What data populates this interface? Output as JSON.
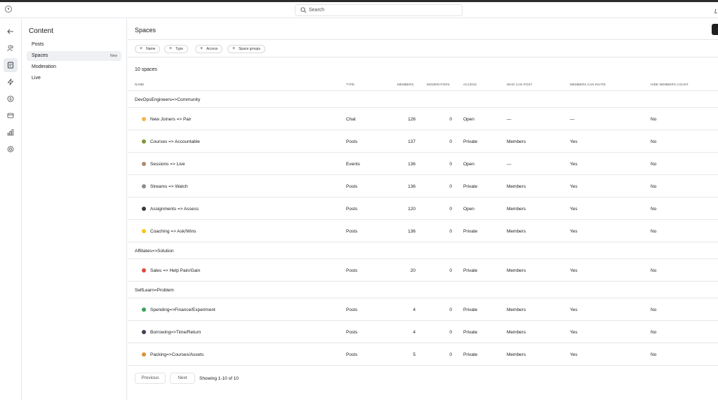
{
  "topbar": {
    "search_placeholder": "Search",
    "avatar_letter": "L"
  },
  "subnav": {
    "title": "Content",
    "items": [
      {
        "label": "Posts",
        "badge": ""
      },
      {
        "label": "Spaces",
        "badge": "New"
      },
      {
        "label": "Moderation",
        "badge": ""
      },
      {
        "label": "Live",
        "badge": ""
      }
    ]
  },
  "main": {
    "title": "Spaces",
    "filters": [
      "Name",
      "Type",
      "Access",
      "Space groups"
    ],
    "count": "10 spaces",
    "columns": [
      "NAME",
      "TYPE",
      "MEMBERS",
      "MODERATORS",
      "ACCESS",
      "WHO CAN POST",
      "MEMBERS CAN INVITE",
      "HIDE MEMBERS COUNT"
    ],
    "groups": [
      {
        "label": "DevOpsEngineers=>Community",
        "rows": [
          {
            "icon": "waving-hand-icon",
            "color": "#f2b84b",
            "name": "New Joiners => Pair",
            "type": "Chat",
            "members": "126",
            "moderators": "0",
            "access": "Open",
            "who_can_post": "—",
            "can_invite": "—",
            "hide_count": "No"
          },
          {
            "icon": "books-icon",
            "color": "#7a9a3a",
            "name": "Courses => Accountable",
            "type": "Posts",
            "members": "137",
            "moderators": "0",
            "access": "Private",
            "who_can_post": "Members",
            "can_invite": "Yes",
            "hide_count": "No"
          },
          {
            "icon": "person-icon",
            "color": "#b08a6a",
            "name": "Sessions => Live",
            "type": "Events",
            "members": "136",
            "moderators": "0",
            "access": "Open",
            "who_can_post": "—",
            "can_invite": "Yes",
            "hide_count": "No"
          },
          {
            "icon": "streams-icon",
            "color": "#8c8c8c",
            "name": "Streams => Watch",
            "type": "Posts",
            "members": "136",
            "moderators": "0",
            "access": "Private",
            "who_can_post": "Members",
            "can_invite": "Yes",
            "hide_count": "No"
          },
          {
            "icon": "eyes-icon",
            "color": "#3a3a3a",
            "name": "Assignments => Assess",
            "type": "Posts",
            "members": "120",
            "moderators": "0",
            "access": "Open",
            "who_can_post": "Members",
            "can_invite": "Yes",
            "hide_count": "No"
          },
          {
            "icon": "sparkle-icon",
            "color": "#f5c71a",
            "name": "Coaching => Ask/Wins",
            "type": "Posts",
            "members": "136",
            "moderators": "0",
            "access": "Private",
            "who_can_post": "Members",
            "can_invite": "Yes",
            "hide_count": "No"
          }
        ]
      },
      {
        "label": "Affiliates=>Solution",
        "rows": [
          {
            "icon": "pencil-icon",
            "color": "#e0483e",
            "name": "Sales => Help Pain/Gain",
            "type": "Posts",
            "members": "20",
            "moderators": "0",
            "access": "Private",
            "who_can_post": "Members",
            "can_invite": "Yes",
            "hide_count": "No"
          }
        ]
      },
      {
        "label": "SelfLearn=Problem",
        "rows": [
          {
            "icon": "gem-icon",
            "color": "#3aa05a",
            "name": "Spending=>Finance/Experiment",
            "type": "Posts",
            "members": "4",
            "moderators": "0",
            "access": "Private",
            "who_can_post": "Members",
            "can_invite": "Yes",
            "hide_count": "No"
          },
          {
            "icon": "ball-icon",
            "color": "#4a3a52",
            "name": "Borrowing=>Time/Return",
            "type": "Posts",
            "members": "4",
            "moderators": "0",
            "access": "Private",
            "who_can_post": "Members",
            "can_invite": "Yes",
            "hide_count": "No"
          },
          {
            "icon": "box-icon",
            "color": "#e0903a",
            "name": "Packing=>Courses/Assets",
            "type": "Posts",
            "members": "5",
            "moderators": "0",
            "access": "Private",
            "who_can_post": "Members",
            "can_invite": "Yes",
            "hide_count": "No"
          }
        ]
      }
    ],
    "pagination": {
      "previous": "Previous",
      "next": "Next",
      "info": "Showing 1-10 of 10"
    }
  }
}
